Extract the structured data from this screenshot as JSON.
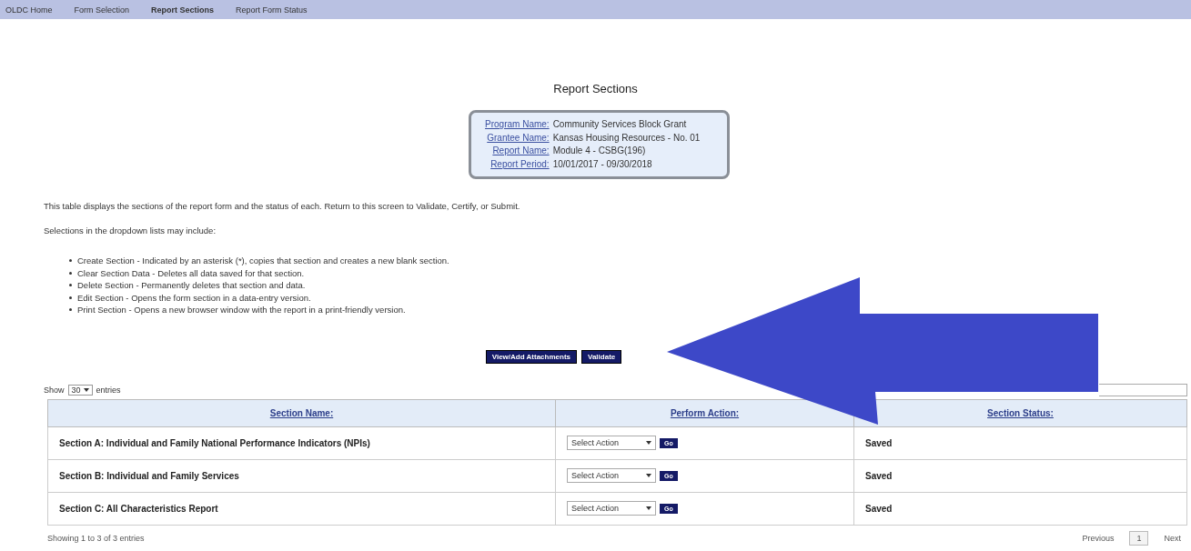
{
  "nav": [
    {
      "label": "OLDC Home",
      "selected": false
    },
    {
      "label": "Form Selection",
      "selected": false
    },
    {
      "label": "Report Sections",
      "selected": true
    },
    {
      "label": "Report Form Status",
      "selected": false
    }
  ],
  "page_title": "Report Sections",
  "info_box": [
    {
      "label": "Program Name:",
      "value": "Community Services Block Grant"
    },
    {
      "label": "Grantee Name:",
      "value": "Kansas Housing Resources - No. 01"
    },
    {
      "label": "Report Name:",
      "value": "Module 4 - CSBG(196)"
    },
    {
      "label": "Report Period:",
      "value": "10/01/2017 - 09/30/2018"
    }
  ],
  "intro": "This table displays the sections of the report form and the status of each. Return to this screen to Validate, Certify, or Submit.",
  "list_intro": "Selections in the dropdown lists may include:",
  "list_items": [
    "Create Section - Indicated by an asterisk (*), copies that section and creates a new blank section.",
    "Clear Section Data - Deletes all data saved for that section.",
    "Delete Section - Permanently deletes that section and data.",
    "Edit Section - Opens the form section in a data-entry version.",
    "Print Section - Opens a new browser window with the report in a print-friendly version."
  ],
  "buttons": [
    "View/Add Attachments",
    "Validate"
  ],
  "length_menu": {
    "before": "Show",
    "value": "30",
    "after": "entries"
  },
  "table": {
    "columns": [
      "Section Name:",
      "Perform Action:",
      "Section Status:"
    ],
    "rows": [
      {
        "name": "Section A: Individual and Family National Performance Indicators (NPIs)",
        "action": "Select Action",
        "go": "Go",
        "status": "Saved"
      },
      {
        "name": "Section B: Individual and Family Services",
        "action": "Select Action",
        "go": "Go",
        "status": "Saved"
      },
      {
        "name": "Section C: All Characteristics Report",
        "action": "Select Action",
        "go": "Go",
        "status": "Saved"
      }
    ]
  },
  "info": "Showing 1 to 3 of 3 entries",
  "pagination": [
    {
      "label": "Previous",
      "selected": false
    },
    {
      "label": "1",
      "selected": true
    },
    {
      "label": "Next",
      "selected": false
    }
  ]
}
